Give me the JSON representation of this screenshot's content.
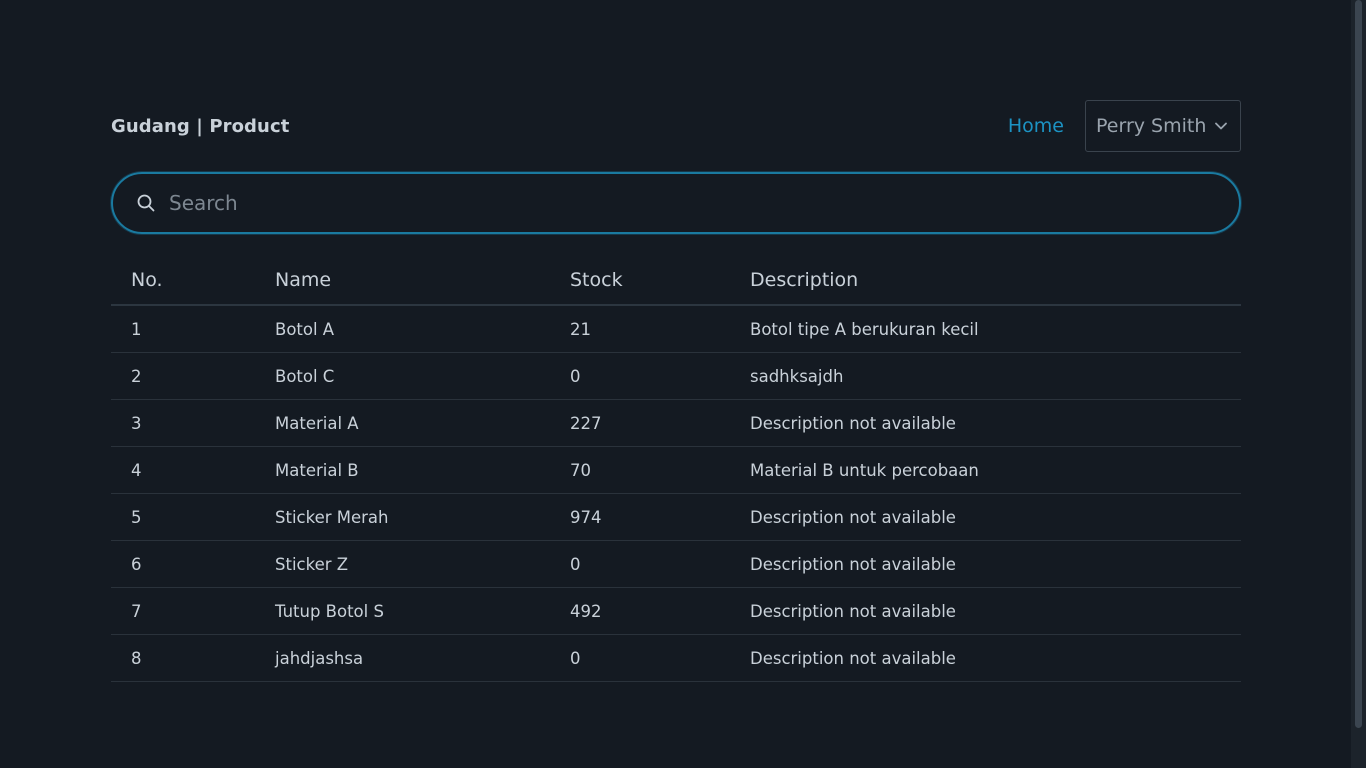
{
  "header": {
    "brand": "Gudang | Product",
    "home_link": "Home",
    "user_name": "Perry Smith"
  },
  "search": {
    "placeholder": "Search",
    "value": ""
  },
  "table": {
    "headers": [
      "No.",
      "Name",
      "Stock",
      "Description"
    ],
    "rows": [
      [
        "1",
        "Botol A",
        "21",
        "Botol tipe A berukuran kecil"
      ],
      [
        "2",
        "Botol C",
        "0",
        "sadhksajdh"
      ],
      [
        "3",
        "Material A",
        "227",
        "Description not available"
      ],
      [
        "4",
        "Material B",
        "70",
        "Material B untuk percobaan"
      ],
      [
        "5",
        "Sticker Merah",
        "974",
        "Description not available"
      ],
      [
        "6",
        "Sticker Z",
        "0",
        "Description not available"
      ],
      [
        "7",
        "Tutup Botol S",
        "492",
        "Description not available"
      ],
      [
        "8",
        "jahdjashsa",
        "0",
        "Description not available"
      ]
    ]
  },
  "colors": {
    "background": "#141a22",
    "accent": "#1c93c4",
    "text": "#c9d1d9"
  },
  "icons": {
    "search": "search-icon",
    "dropdown": "chevron-down-icon"
  }
}
